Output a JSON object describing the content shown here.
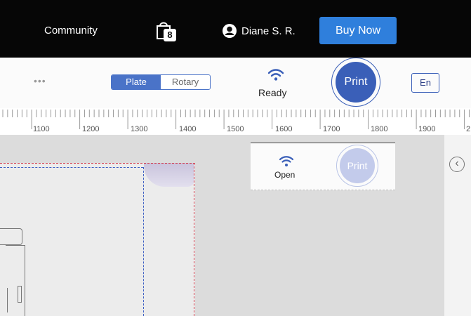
{
  "topbar": {
    "community_label": "Community",
    "cart_count": "8",
    "user_name": "Diane S. R.",
    "buy_label": "Buy Now",
    "icons": [
      "shopping-bag-icon",
      "user-avatar-icon"
    ]
  },
  "toolbar": {
    "more_label": "•••",
    "mode_options": [
      "Plate",
      "Rotary"
    ],
    "mode_selected": "Plate",
    "status_label": "Ready",
    "print_label": "Print",
    "language_label": "En"
  },
  "ruler": {
    "labels": [
      "1100",
      "1200",
      "1300",
      "1400",
      "1500",
      "1600",
      "1700",
      "1800",
      "1900",
      "2"
    ]
  },
  "floating_panel": {
    "status_label": "Open",
    "print_label": "Print"
  },
  "colors": {
    "topbar_bg": "#060606",
    "buy_button": "#2f7fdc",
    "print_primary": "#3a5fb8",
    "print_disabled": "#c3cbeb",
    "workspace_bg": "#dcdcdc",
    "guide_blue": "#3c5fc4",
    "guide_red": "#d23a4a"
  }
}
